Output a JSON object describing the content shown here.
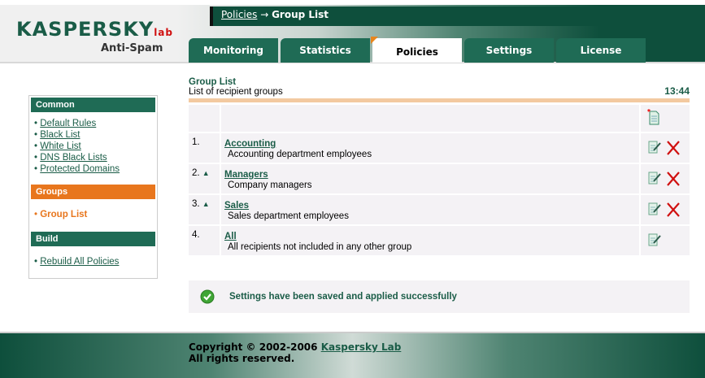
{
  "header": {
    "logo": "KASPERSKY",
    "logo_lab": "lab",
    "product": "Anti-Spam",
    "breadcrumb_link": "Policies",
    "breadcrumb_sep": " → ",
    "breadcrumb_current": "Group List"
  },
  "tabs": [
    {
      "label": "Monitoring"
    },
    {
      "label": "Statistics"
    },
    {
      "label": "Policies",
      "active": true
    },
    {
      "label": "Settings"
    },
    {
      "label": "License"
    }
  ],
  "sidebar": {
    "common": "Common",
    "common_items": [
      "Default Rules",
      "Black List",
      "White List",
      "DNS Black Lists",
      "Protected Domains"
    ],
    "groups": "Groups",
    "group_items": [
      "Group List"
    ],
    "build": "Build",
    "build_items": [
      "Rebuild All Policies"
    ]
  },
  "main": {
    "title": "Group List",
    "subtitle": "List of recipient groups",
    "time": "13:44",
    "groups": [
      {
        "num": "1.",
        "up": false,
        "name": "Accounting",
        "desc": "Accounting department employees",
        "deletable": true
      },
      {
        "num": "2.",
        "up": true,
        "name": "Managers",
        "desc": "Company managers",
        "deletable": true
      },
      {
        "num": "3.",
        "up": true,
        "name": "Sales",
        "desc": "Sales department employees",
        "deletable": true
      },
      {
        "num": "4.",
        "up": false,
        "name": "All",
        "desc": "All recipients not included in any other group",
        "deletable": false
      }
    ],
    "status": "Settings have been saved and applied successfully"
  },
  "footer": {
    "copyright": "Copyright © 2002-2006 ",
    "company": "Kaspersky Lab",
    "rights": "All rights reserved."
  },
  "colors": {
    "brand": "#1a5c47",
    "accent": "#e8761d",
    "delete": "#d01010"
  }
}
